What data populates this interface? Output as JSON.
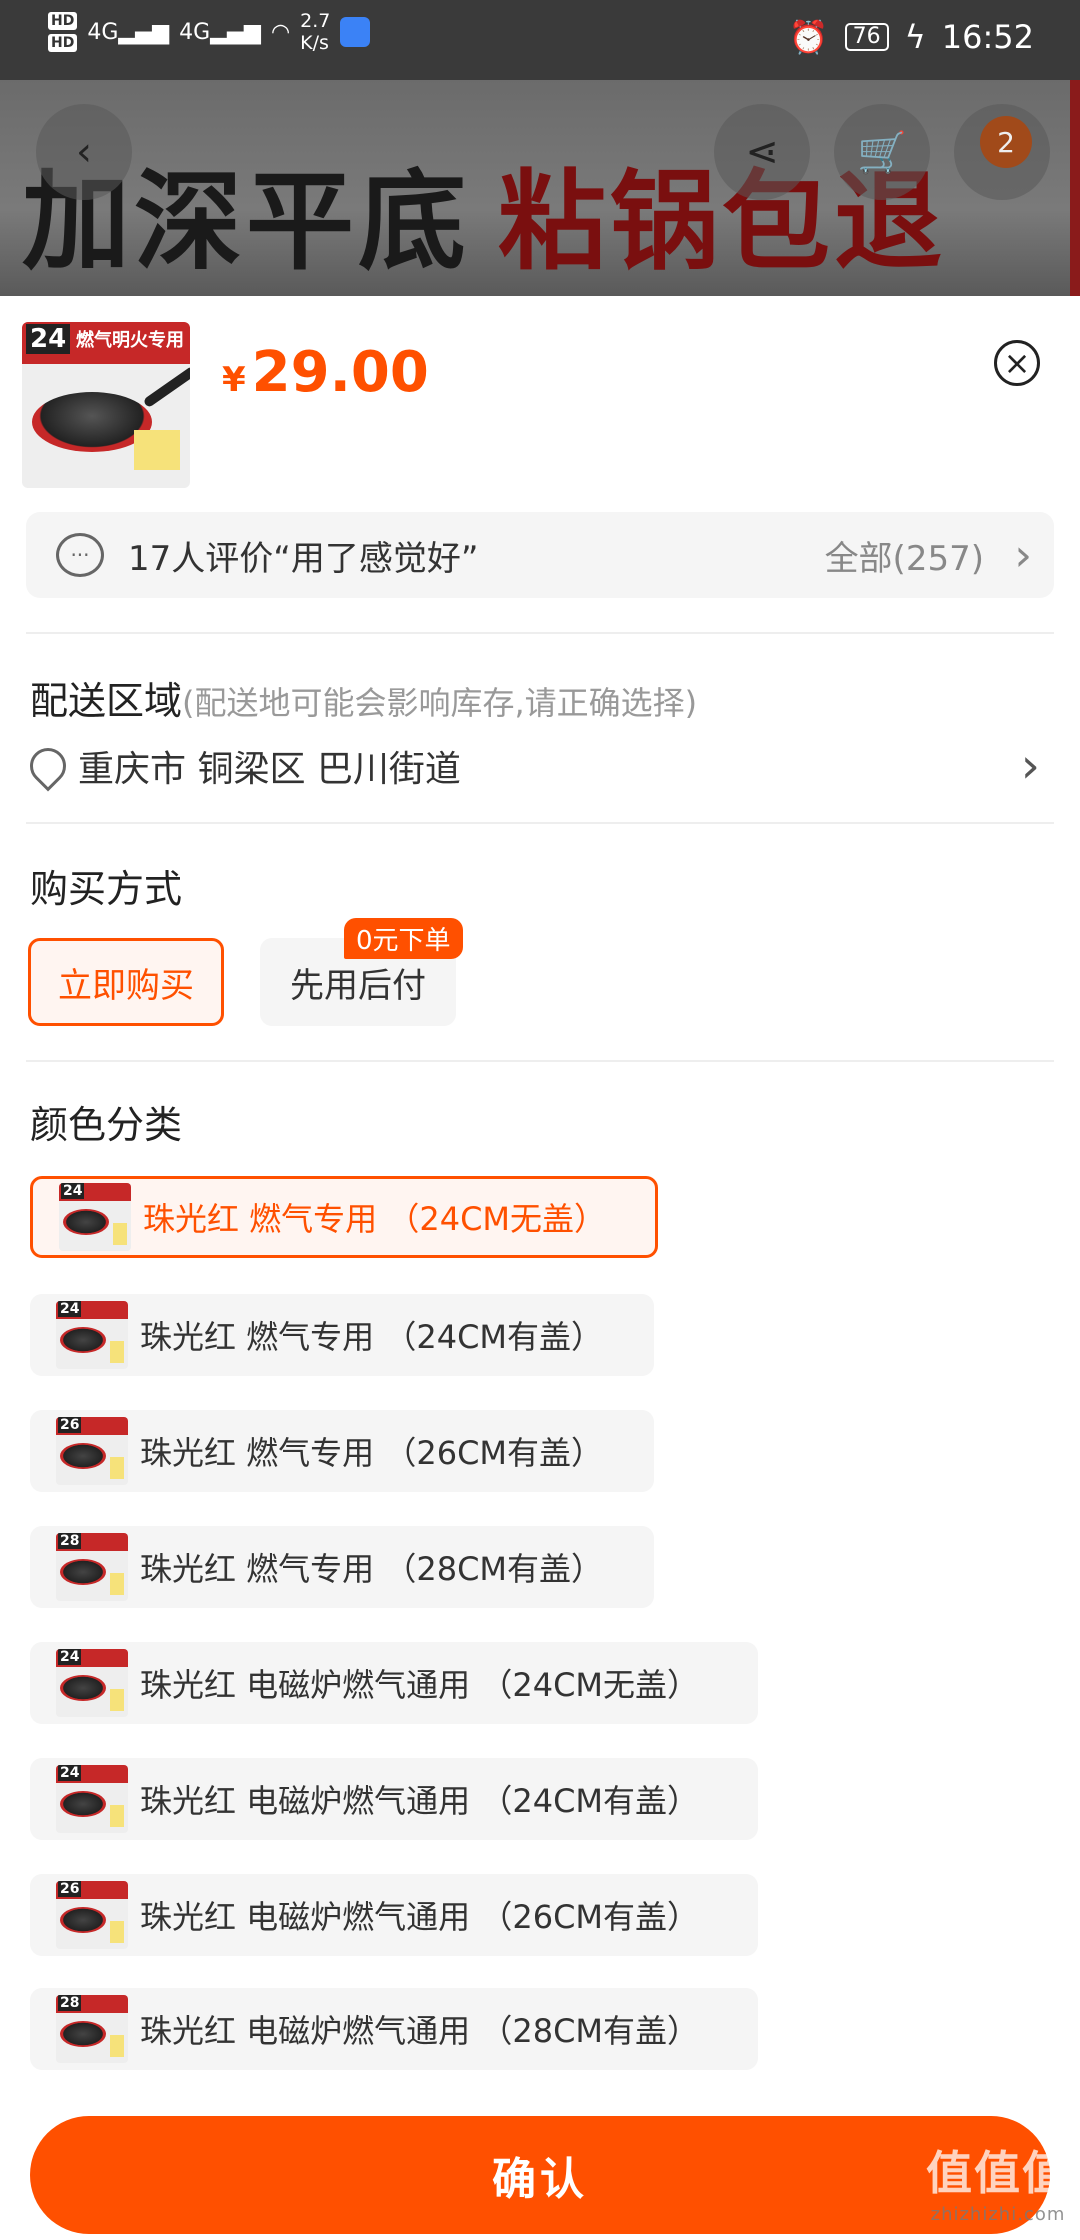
{
  "status_bar": {
    "hd1": "HD",
    "hd2": "HD",
    "net1": "4G",
    "net2": "4G",
    "speed_value": "2.7",
    "speed_unit": "K/s",
    "battery": "76",
    "time": "16:52"
  },
  "banner": {
    "text_black": "加深平底",
    "text_red": "粘锅包退",
    "cart_count": "2"
  },
  "product": {
    "thumb_size": "24",
    "thumb_tag": "燃气明火专用",
    "currency": "¥",
    "price": "29.00"
  },
  "review": {
    "text": "17人评价“用了感觉好”",
    "all_label": "全部(257)"
  },
  "delivery": {
    "title": "配送区域",
    "hint": "(配送地可能会影响库存,请正确选择)",
    "address": "重庆市 铜梁区 巴川街道"
  },
  "purchase": {
    "title": "购买方式",
    "buy_now": "立即购买",
    "buy_later": "先用后付",
    "badge": "0元下单"
  },
  "color": {
    "title": "颜色分类",
    "options": [
      {
        "label": "珠光红 燃气专用 （24CM无盖）",
        "size": "24"
      },
      {
        "label": "珠光红 燃气专用 （24CM有盖）",
        "size": "24"
      },
      {
        "label": "珠光红 燃气专用 （26CM有盖）",
        "size": "26"
      },
      {
        "label": "珠光红 燃气专用 （28CM有盖）",
        "size": "28"
      },
      {
        "label": "珠光红 电磁炉燃气通用 （24CM无盖）",
        "size": "24"
      },
      {
        "label": "珠光红 电磁炉燃气通用 （24CM有盖）",
        "size": "24"
      },
      {
        "label": "珠光红 电磁炉燃气通用 （26CM有盖）",
        "size": "26"
      },
      {
        "label": "珠光红 电磁炉燃气通用 （28CM有盖）",
        "size": "28"
      }
    ]
  },
  "confirm_label": "确认",
  "watermark": {
    "main": "值值值",
    "sub": "zhizhizhi.com"
  },
  "colors": {
    "accent": "#ff5000",
    "banner_red": "#7a0f0f"
  }
}
